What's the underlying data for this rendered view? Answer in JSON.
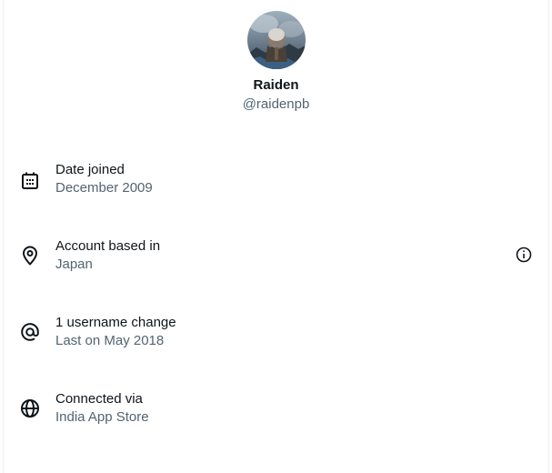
{
  "profile": {
    "display_name": "Raiden",
    "handle": "@raidenpb"
  },
  "details": [
    {
      "icon": "calendar-icon",
      "title": "Date joined",
      "value": "December 2009"
    },
    {
      "icon": "location-pin-icon",
      "title": "Account based in",
      "value": "Japan",
      "info_icon": "info-icon"
    },
    {
      "icon": "at-sign-icon",
      "title": "1 username change",
      "value": "Last on May 2018"
    },
    {
      "icon": "globe-icon",
      "title": "Connected via",
      "value": "India App Store"
    }
  ],
  "colors": {
    "primary_text": "#0f1419",
    "secondary_text": "#536471",
    "border": "#eff3f4",
    "background": "#ffffff"
  }
}
